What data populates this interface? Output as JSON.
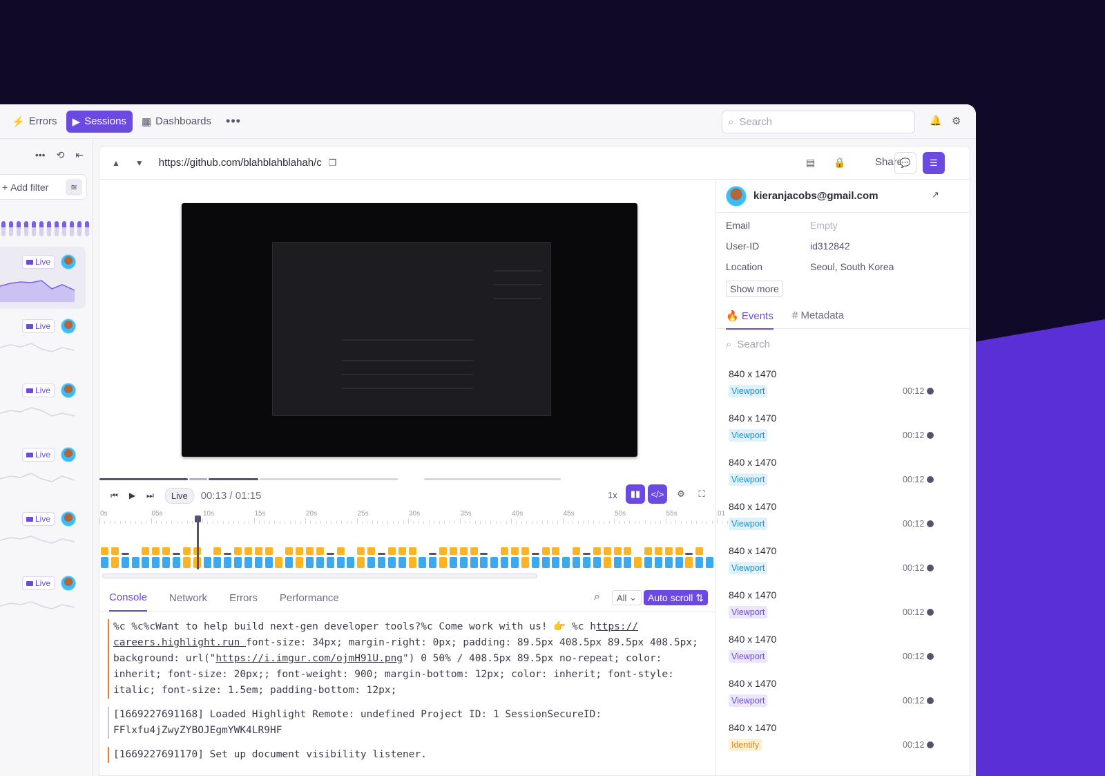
{
  "nav": {
    "items": [
      {
        "label": "Errors",
        "icon": "bolt-icon"
      },
      {
        "label": "Sessions",
        "icon": "play-circle-icon",
        "active": true
      },
      {
        "label": "Dashboards",
        "icon": "grid-icon"
      }
    ],
    "search_placeholder": "Search"
  },
  "sidebar": {
    "add_filter": "Add filter",
    "sessions": [
      {
        "badge": "Live",
        "active": true
      },
      {
        "badge": "Live"
      },
      {
        "badge": "Live"
      },
      {
        "badge": "Live"
      },
      {
        "badge": "Live"
      },
      {
        "badge": "Live"
      }
    ]
  },
  "toolbar": {
    "url": "https://github.com/blahblahblahah/c",
    "share": "Share"
  },
  "player": {
    "live_label": "Live",
    "time": "00:13 / 01:15",
    "speed": "1x",
    "ticks": [
      "0s",
      "05s",
      "10s",
      "15s",
      "20s",
      "25s",
      "30s",
      "35s",
      "40s",
      "45s",
      "50s",
      "55s",
      "01"
    ]
  },
  "devtools": {
    "tabs": [
      "Console",
      "Network",
      "Errors",
      "Performance"
    ],
    "filter": "All",
    "autoscroll": "Auto scroll",
    "logs": [
      {
        "kind": "warn",
        "parts": [
          {
            "t": "%c %c%cWant to help build next-gen developer tools?%c Come work with us! 👉 %c h"
          },
          {
            "t": "ttps:// careers.highlight.run ",
            "u": true
          },
          {
            "t": "font-size: 34px; margin-right: 0px; padding: 89.5px 408.5px 89.5px 408.5px; background: url(\""
          },
          {
            "t": "https://i.imgur.com/ojmH91U.png",
            "u": true
          },
          {
            "t": "\") 0 50% / 408.5px 89.5px no-repeat; color: inherit; font-size: 20px;; font-weight: 900; margin-bottom: 12px; color: inherit; font-style: italic; font-size: 1.5em; padding-bottom: 12px;"
          }
        ]
      },
      {
        "kind": "info",
        "parts": [
          {
            "t": "[1669227691168] Loaded Highlight Remote: undefined Project ID: 1 SessionSecureID: FFlxfu4jZwyZYBOJEgmYWK4LR9HF"
          }
        ]
      },
      {
        "kind": "warn",
        "parts": [
          {
            "t": "[1669227691170] Set up document visibility listener."
          }
        ]
      }
    ]
  },
  "user": {
    "email_title": "kieranjacobs@gmail.com",
    "fields": [
      {
        "key": "Email",
        "value": "Empty",
        "muted": true
      },
      {
        "key": "User-ID",
        "value": "id312842"
      },
      {
        "key": "Location",
        "value": "Seoul, South Korea"
      }
    ],
    "show_more": "Show more",
    "tabs": [
      "Events",
      "Metadata"
    ],
    "search_placeholder": "Search",
    "events": [
      {
        "size": "840 x 1470",
        "tag": "Viewport",
        "color": "blue",
        "time": "00:12"
      },
      {
        "size": "840 x 1470",
        "tag": "Viewport",
        "color": "blue",
        "time": "00:12"
      },
      {
        "size": "840 x 1470",
        "tag": "Viewport",
        "color": "blue",
        "time": "00:12"
      },
      {
        "size": "840 x 1470",
        "tag": "Viewport",
        "color": "blue",
        "time": "00:12"
      },
      {
        "size": "840 x 1470",
        "tag": "Viewport",
        "color": "blue",
        "time": "00:12"
      },
      {
        "size": "840 x 1470",
        "tag": "Viewport",
        "color": "purple",
        "time": "00:12"
      },
      {
        "size": "840 x 1470",
        "tag": "Viewport",
        "color": "purple",
        "time": "00:12"
      },
      {
        "size": "840 x 1470",
        "tag": "Viewport",
        "color": "purple",
        "time": "00:12"
      },
      {
        "size": "840 x 1470",
        "tag": "Identify",
        "color": "orange",
        "time": "00:12"
      }
    ]
  },
  "colors": {
    "accent": "#6a4ae0",
    "bg": "#100a28",
    "wedge": "#5b2fd6",
    "blue_bar": "#3aa9f0",
    "orange_bar": "#fbb424"
  }
}
